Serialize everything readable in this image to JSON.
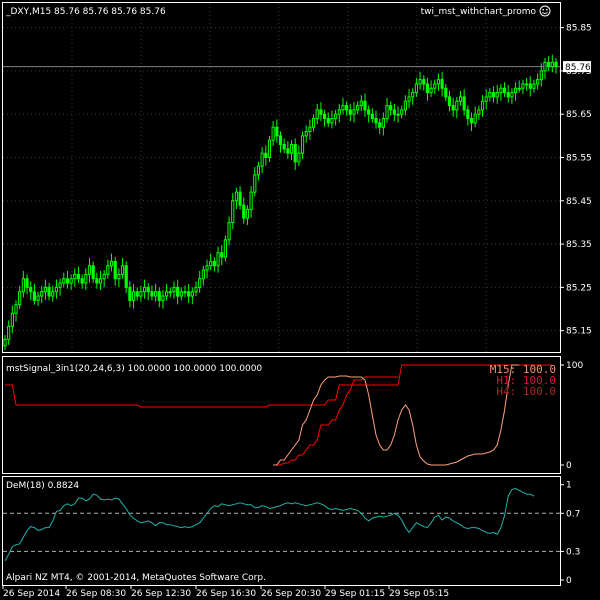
{
  "window": {
    "title": "_DXY,M15  85.76 85.76 85.76 85.76",
    "expert": "twi_mst_withchart_promo",
    "expert_icon": "smiley-icon",
    "footer": "Alpari NZ MT4, © 2001-2014, MetaQuotes Software Corp."
  },
  "colors": {
    "background": "#000000",
    "frame": "#ffffff",
    "grid": "#2a3a4a",
    "candles": "#00ff00",
    "signal_line": "#ff0000",
    "signal_curve": "#ffa07a",
    "dem_line": "#20b2aa",
    "bid_line": "#808080"
  },
  "chart_data": [
    {
      "type": "candlestick",
      "title": "_DXY,M15  85.76 85.76 85.76 85.76",
      "yticks": [
        "85.85",
        "85.75",
        "85.65",
        "85.55",
        "85.45",
        "85.35",
        "85.25",
        "85.15"
      ],
      "current_price_label": "85.76",
      "ylim": [
        85.11,
        85.9
      ],
      "closes": [
        85.13,
        85.16,
        85.19,
        85.21,
        85.24,
        85.27,
        85.25,
        85.24,
        85.22,
        85.23,
        85.24,
        85.25,
        85.23,
        85.24,
        85.25,
        85.26,
        85.27,
        85.26,
        85.27,
        85.28,
        85.27,
        85.26,
        85.28,
        85.3,
        85.27,
        85.26,
        85.27,
        85.28,
        85.3,
        85.31,
        85.27,
        85.28,
        85.3,
        85.25,
        85.22,
        85.24,
        85.23,
        85.24,
        85.25,
        85.24,
        85.23,
        85.24,
        85.22,
        85.23,
        85.24,
        85.24,
        85.25,
        85.23,
        85.24,
        85.24,
        85.23,
        85.24,
        85.25,
        85.27,
        85.29,
        85.3,
        85.31,
        85.3,
        85.33,
        85.32,
        85.36,
        85.4,
        85.45,
        85.47,
        85.44,
        85.41,
        85.43,
        85.47,
        85.51,
        85.53,
        85.56,
        85.55,
        85.59,
        85.62,
        85.6,
        85.58,
        85.57,
        85.56,
        85.58,
        85.54,
        85.56,
        85.6,
        85.61,
        85.62,
        85.64,
        85.66,
        85.65,
        85.64,
        85.63,
        85.64,
        85.65,
        85.66,
        85.67,
        85.66,
        85.65,
        85.66,
        85.67,
        85.68,
        85.66,
        85.65,
        85.64,
        85.63,
        85.62,
        85.64,
        85.67,
        85.66,
        85.65,
        85.65,
        85.66,
        85.68,
        85.69,
        85.7,
        85.72,
        85.73,
        85.72,
        85.7,
        85.71,
        85.72,
        85.73,
        85.71,
        85.69,
        85.67,
        85.66,
        85.68,
        85.69,
        85.66,
        85.64,
        85.63,
        85.65,
        85.66,
        85.68,
        85.69,
        85.7,
        85.69,
        85.7,
        85.71,
        85.7,
        85.69,
        85.7,
        85.71,
        85.71,
        85.72,
        85.72,
        85.71,
        85.72,
        85.73,
        85.75,
        85.77,
        85.76,
        85.77,
        85.76
      ]
    },
    {
      "type": "line",
      "title": "mstSignal_3in1(20,24,6,3) 100.0000 100.0000 100.0000",
      "yticks": [
        "100",
        "0"
      ],
      "ylim": [
        -5,
        105
      ],
      "timeframes": [
        {
          "label": "M15",
          "sep": ":",
          "value": "100.0",
          "color": "#ff8c69"
        },
        {
          "label": "H1",
          "sep": ":",
          "value": "100.0",
          "color": "#dc143c"
        },
        {
          "label": "H4",
          "sep": ":",
          "value": "100.0",
          "color": "#b22222"
        }
      ],
      "series": [
        {
          "color": "#ff0000",
          "values": [
            80,
            80,
            80,
            60,
            60,
            60,
            60,
            60,
            60,
            60,
            60,
            60,
            60,
            60,
            60,
            60,
            60,
            60,
            60,
            60,
            60,
            60,
            60,
            60,
            60,
            60,
            60,
            60,
            60,
            60,
            60,
            60,
            60,
            60,
            60,
            60,
            60,
            58,
            58,
            58,
            58,
            58,
            58,
            58,
            58,
            58,
            58,
            58,
            58,
            58,
            58,
            58,
            58,
            58,
            58,
            58,
            58,
            58,
            58,
            58,
            58,
            58,
            58,
            58,
            58,
            58,
            58,
            58,
            58,
            58,
            58,
            58,
            60,
            60,
            60,
            60,
            60,
            60,
            60,
            60,
            60,
            60,
            60,
            60,
            60,
            60,
            60,
            60,
            65,
            65,
            65,
            80,
            80,
            80,
            80,
            80,
            80,
            80,
            80,
            80,
            80,
            80,
            80,
            80,
            80,
            80,
            80,
            80,
            100,
            100,
            100,
            100,
            100,
            100,
            100,
            100,
            100,
            100,
            100,
            100,
            100,
            100,
            100,
            100,
            100,
            100,
            100,
            100,
            100,
            100,
            100,
            100,
            100,
            100,
            100,
            100,
            100,
            100,
            100,
            100,
            100,
            100,
            100,
            100,
            100,
            100,
            100,
            100,
            100,
            100
          ]
        },
        {
          "color": "#ff0000",
          "values": [
            null,
            null,
            null,
            null,
            null,
            null,
            null,
            null,
            null,
            null,
            null,
            null,
            null,
            null,
            null,
            null,
            null,
            null,
            null,
            null,
            null,
            null,
            null,
            null,
            null,
            null,
            null,
            null,
            null,
            null,
            null,
            null,
            null,
            null,
            null,
            null,
            null,
            null,
            null,
            null,
            null,
            null,
            null,
            null,
            null,
            null,
            null,
            null,
            null,
            null,
            null,
            null,
            null,
            null,
            null,
            null,
            null,
            null,
            null,
            null,
            null,
            null,
            null,
            null,
            null,
            null,
            null,
            null,
            null,
            null,
            null,
            null,
            null,
            0,
            0,
            0,
            2,
            2,
            5,
            5,
            10,
            10,
            15,
            20,
            20,
            25,
            40,
            40,
            40,
            45,
            45,
            55,
            60,
            70,
            75,
            85,
            85,
            85,
            88,
            88,
            88,
            88,
            88,
            88,
            88,
            88,
            88,
            88,
            null,
            null,
            null,
            null,
            null,
            null,
            null,
            null,
            null,
            null,
            null,
            null,
            null,
            null,
            null,
            null,
            null,
            null,
            null,
            null,
            null,
            null,
            null,
            null,
            null,
            null,
            null,
            null,
            null,
            null,
            null,
            null,
            null,
            null,
            null,
            null,
            null,
            null,
            null,
            null,
            null,
            null,
            null
          ]
        },
        {
          "color": "#ffa07a",
          "values": [
            null,
            null,
            null,
            null,
            null,
            null,
            null,
            null,
            null,
            null,
            null,
            null,
            null,
            null,
            null,
            null,
            null,
            null,
            null,
            null,
            null,
            null,
            null,
            null,
            null,
            null,
            null,
            null,
            null,
            null,
            null,
            null,
            null,
            null,
            null,
            null,
            null,
            null,
            null,
            null,
            null,
            null,
            null,
            null,
            null,
            null,
            null,
            null,
            null,
            null,
            null,
            null,
            null,
            null,
            null,
            null,
            null,
            null,
            null,
            null,
            null,
            null,
            null,
            null,
            null,
            null,
            null,
            null,
            null,
            null,
            null,
            null,
            null,
            0,
            0,
            5,
            5,
            10,
            15,
            20,
            25,
            40,
            45,
            55,
            65,
            70,
            80,
            85,
            88,
            88,
            88,
            89,
            89,
            89,
            88,
            88,
            88,
            88,
            85,
            70,
            50,
            30,
            20,
            15,
            15,
            20,
            30,
            45,
            55,
            60,
            55,
            40,
            20,
            8,
            4,
            1,
            0,
            0,
            0,
            0,
            0,
            1,
            2,
            3,
            5,
            7,
            9,
            10,
            11,
            11,
            11,
            12,
            13,
            15,
            20,
            35,
            55,
            80,
            100,
            100,
            100,
            null,
            null,
            null,
            null,
            null,
            null,
            null
          ]
        }
      ]
    },
    {
      "type": "line",
      "title": "DeM(18) 0.8824",
      "yticks": [
        "1",
        "0.7",
        "0.3",
        "0"
      ],
      "ylim": [
        0,
        1.06
      ],
      "series": [
        {
          "color": "#20b2aa",
          "values": [
            0.2,
            0.27,
            0.35,
            0.37,
            0.38,
            0.45,
            0.52,
            0.56,
            0.55,
            0.52,
            0.53,
            0.55,
            0.55,
            0.62,
            0.72,
            0.73,
            0.78,
            0.8,
            0.78,
            0.8,
            0.86,
            0.86,
            0.83,
            0.85,
            0.9,
            0.89,
            0.85,
            0.84,
            0.85,
            0.84,
            0.86,
            0.85,
            0.8,
            0.75,
            0.68,
            0.65,
            0.62,
            0.6,
            0.61,
            0.62,
            0.6,
            0.57,
            0.6,
            0.6,
            0.58,
            0.58,
            0.57,
            0.56,
            0.55,
            0.56,
            0.55,
            0.56,
            0.58,
            0.6,
            0.65,
            0.7,
            0.75,
            0.78,
            0.77,
            0.8,
            0.79,
            0.78,
            0.79,
            0.8,
            0.81,
            0.8,
            0.79,
            0.79,
            0.76,
            0.76,
            0.78,
            0.77,
            0.75,
            0.76,
            0.77,
            0.78,
            0.8,
            0.81,
            0.8,
            0.81,
            0.8,
            0.79,
            0.78,
            0.79,
            0.8,
            0.81,
            0.8,
            0.78,
            0.75,
            0.74,
            0.75,
            0.74,
            0.73,
            0.74,
            0.75,
            0.74,
            0.73,
            0.7,
            0.65,
            0.62,
            0.65,
            0.66,
            0.67,
            0.66,
            0.67,
            0.68,
            0.7,
            0.68,
            0.63,
            0.55,
            0.5,
            0.55,
            0.6,
            0.58,
            0.56,
            0.55,
            0.6,
            0.66,
            0.68,
            0.63,
            0.66,
            0.65,
            0.62,
            0.6,
            0.58,
            0.55,
            0.54,
            0.55,
            0.55,
            0.54,
            0.52,
            0.5,
            0.49,
            0.5,
            0.48,
            0.55,
            0.68,
            0.88,
            0.95,
            0.96,
            0.94,
            0.92,
            0.9,
            0.9,
            0.88
          ]
        }
      ]
    }
  ],
  "time_axis": [
    "26 Sep 2014",
    "26 Sep 08:30",
    "26 Sep 12:30",
    "26 Sep 16:30",
    "26 Sep 20:30",
    "29 Sep 01:15",
    "29 Sep 05:15"
  ]
}
